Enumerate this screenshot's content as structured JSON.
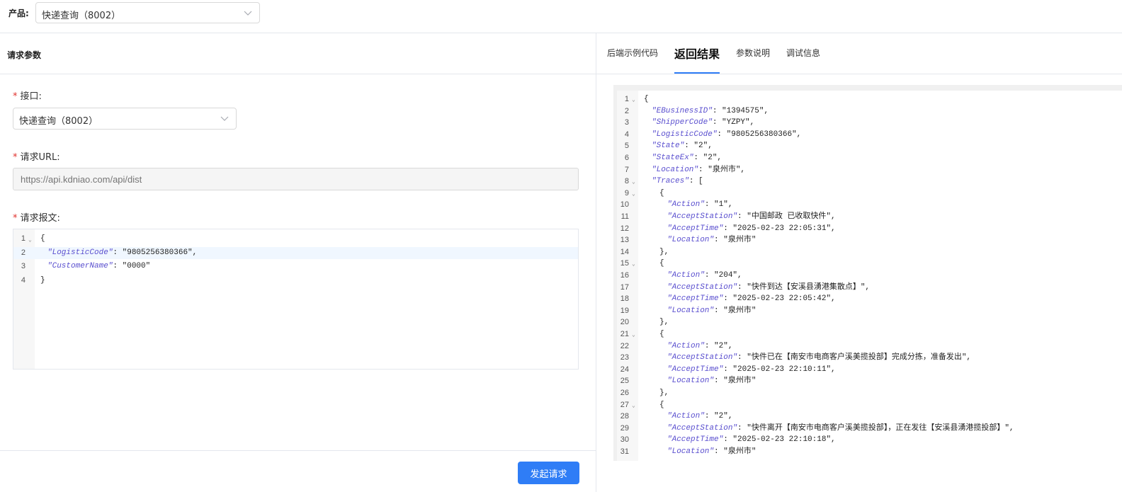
{
  "product": {
    "label": "产品:",
    "selected": "快递查询（8002）"
  },
  "request": {
    "header": "请求参数",
    "interface_label": "接口:",
    "interface_selected": "快递查询（8002）",
    "url_label": "请求URL:",
    "url_placeholder": "https://api.kdniao.com/api/dist",
    "body_label": "请求报文:",
    "body_lines": [
      {
        "num": "1",
        "fold": true,
        "indent": 0,
        "key": "",
        "sep": "",
        "val": "{"
      },
      {
        "num": "2",
        "fold": false,
        "indent": 1,
        "key": "\"LogisticCode\"",
        "sep": ": ",
        "val": "\"9805256380366\","
      },
      {
        "num": "3",
        "fold": false,
        "indent": 1,
        "key": "\"CustomerName\"",
        "sep": ": ",
        "val": "\"0000\""
      },
      {
        "num": "4",
        "fold": false,
        "indent": 0,
        "key": "",
        "sep": "",
        "val": "}"
      }
    ],
    "send_button": "发起请求"
  },
  "tabs": [
    {
      "label": "后端示例代码",
      "active": false
    },
    {
      "label": "返回结果",
      "active": true
    },
    {
      "label": "参数说明",
      "active": false
    },
    {
      "label": "调试信息",
      "active": false
    }
  ],
  "response_lines": [
    {
      "num": "1",
      "fold": true,
      "indent": 0,
      "key": "",
      "sep": "",
      "val": "{"
    },
    {
      "num": "2",
      "fold": false,
      "indent": 1,
      "key": "\"EBusinessID\"",
      "sep": ": ",
      "val": "\"1394575\","
    },
    {
      "num": "3",
      "fold": false,
      "indent": 1,
      "key": "\"ShipperCode\"",
      "sep": ": ",
      "val": "\"YZPY\","
    },
    {
      "num": "4",
      "fold": false,
      "indent": 1,
      "key": "\"LogisticCode\"",
      "sep": ": ",
      "val": "\"9805256380366\","
    },
    {
      "num": "5",
      "fold": false,
      "indent": 1,
      "key": "\"State\"",
      "sep": ": ",
      "val": "\"2\","
    },
    {
      "num": "6",
      "fold": false,
      "indent": 1,
      "key": "\"StateEx\"",
      "sep": ": ",
      "val": "\"2\","
    },
    {
      "num": "7",
      "fold": false,
      "indent": 1,
      "key": "\"Location\"",
      "sep": ": ",
      "val": "\"泉州市\","
    },
    {
      "num": "8",
      "fold": true,
      "indent": 1,
      "key": "\"Traces\"",
      "sep": ": ",
      "val": "["
    },
    {
      "num": "9",
      "fold": true,
      "indent": 2,
      "key": "",
      "sep": "",
      "val": "{"
    },
    {
      "num": "10",
      "fold": false,
      "indent": 3,
      "key": "\"Action\"",
      "sep": ": ",
      "val": "\"1\","
    },
    {
      "num": "11",
      "fold": false,
      "indent": 3,
      "key": "\"AcceptStation\"",
      "sep": ": ",
      "val": "\"中国邮政 已收取快件\","
    },
    {
      "num": "12",
      "fold": false,
      "indent": 3,
      "key": "\"AcceptTime\"",
      "sep": ": ",
      "val": "\"2025-02-23 22:05:31\","
    },
    {
      "num": "13",
      "fold": false,
      "indent": 3,
      "key": "\"Location\"",
      "sep": ": ",
      "val": "\"泉州市\""
    },
    {
      "num": "14",
      "fold": false,
      "indent": 2,
      "key": "",
      "sep": "",
      "val": "},"
    },
    {
      "num": "15",
      "fold": true,
      "indent": 2,
      "key": "",
      "sep": "",
      "val": "{"
    },
    {
      "num": "16",
      "fold": false,
      "indent": 3,
      "key": "\"Action\"",
      "sep": ": ",
      "val": "\"204\","
    },
    {
      "num": "17",
      "fold": false,
      "indent": 3,
      "key": "\"AcceptStation\"",
      "sep": ": ",
      "val": "\"快件到达【安溪县湧港集散点】\","
    },
    {
      "num": "18",
      "fold": false,
      "indent": 3,
      "key": "\"AcceptTime\"",
      "sep": ": ",
      "val": "\"2025-02-23 22:05:42\","
    },
    {
      "num": "19",
      "fold": false,
      "indent": 3,
      "key": "\"Location\"",
      "sep": ": ",
      "val": "\"泉州市\""
    },
    {
      "num": "20",
      "fold": false,
      "indent": 2,
      "key": "",
      "sep": "",
      "val": "},"
    },
    {
      "num": "21",
      "fold": true,
      "indent": 2,
      "key": "",
      "sep": "",
      "val": "{"
    },
    {
      "num": "22",
      "fold": false,
      "indent": 3,
      "key": "\"Action\"",
      "sep": ": ",
      "val": "\"2\","
    },
    {
      "num": "23",
      "fold": false,
      "indent": 3,
      "key": "\"AcceptStation\"",
      "sep": ": ",
      "val": "\"快件已在【南安市电商客户溪美揽投部】完成分拣，准备发出\","
    },
    {
      "num": "24",
      "fold": false,
      "indent": 3,
      "key": "\"AcceptTime\"",
      "sep": ": ",
      "val": "\"2025-02-23 22:10:11\","
    },
    {
      "num": "25",
      "fold": false,
      "indent": 3,
      "key": "\"Location\"",
      "sep": ": ",
      "val": "\"泉州市\""
    },
    {
      "num": "26",
      "fold": false,
      "indent": 2,
      "key": "",
      "sep": "",
      "val": "},"
    },
    {
      "num": "27",
      "fold": true,
      "indent": 2,
      "key": "",
      "sep": "",
      "val": "{"
    },
    {
      "num": "28",
      "fold": false,
      "indent": 3,
      "key": "\"Action\"",
      "sep": ": ",
      "val": "\"2\","
    },
    {
      "num": "29",
      "fold": false,
      "indent": 3,
      "key": "\"AcceptStation\"",
      "sep": ": ",
      "val": "\"快件离开【南安市电商客户溪美揽投部】，正在发往【安溪县湧港揽投部】\","
    },
    {
      "num": "30",
      "fold": false,
      "indent": 3,
      "key": "\"AcceptTime\"",
      "sep": ": ",
      "val": "\"2025-02-23 22:10:18\","
    },
    {
      "num": "31",
      "fold": false,
      "indent": 3,
      "key": "\"Location\"",
      "sep": ": ",
      "val": "\"泉州市\""
    }
  ],
  "icons": {
    "dropdown": "chevron-down-icon",
    "fold": "fold-toggle-icon"
  },
  "colors": {
    "accent": "#2f7df6",
    "required_star": "#e0312c",
    "json_key": "#5a4fcf"
  }
}
